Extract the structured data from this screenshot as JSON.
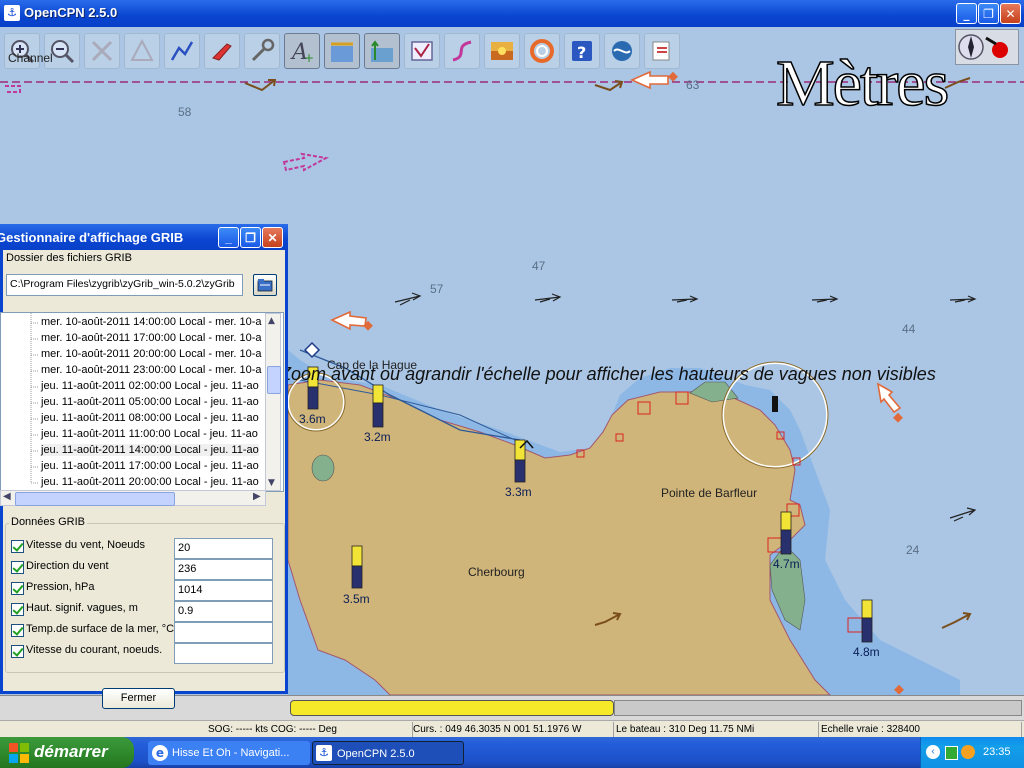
{
  "window": {
    "title": "OpenCPN 2.5.0",
    "buttons": {
      "minimize": "_",
      "maximize": "❐",
      "close": "✕"
    }
  },
  "toolbar": {
    "icons": [
      "zoom-in-icon",
      "zoom-out-icon",
      "scale-in-icon",
      "scale-out-icon",
      "route-icon",
      "ship-icon",
      "settings-icon",
      "text-icon",
      "tide-icon",
      "current-icon",
      "ais-icon",
      "track-icon",
      "color-scheme-icon",
      "mob-icon",
      "help-icon",
      "globe-icon",
      "print-icon"
    ],
    "channel_label": "Channel"
  },
  "chart": {
    "units_label": "Mètres",
    "banner": "Zoom avant ou agrandir l'échelle pour afficher les hauteurs de vagues non visibles",
    "depths": [
      "58",
      "63",
      "47",
      "57",
      "44",
      "24"
    ],
    "places": {
      "cap": "Cap de la Hague",
      "barfleur": "Pointe de Barfleur",
      "cherbourg": "Cherbourg"
    },
    "waves": [
      "3.6m",
      "3.2m",
      "3.3m",
      "4.7m",
      "3.5m",
      "4.8m"
    ]
  },
  "status": {
    "sog": "SOG: ----- kts  COG: ----- Deg",
    "position": "Curs. : 049 46.3035 N 001 51.1976 W",
    "bearing": "Le  bateau : 310 Deg   11.75 NMi",
    "scale": "Echelle vraie :   328400"
  },
  "taskbar": {
    "start": "démarrer",
    "tasks": [
      "Hisse Et Oh - Navigati...",
      "OpenCPN 2.5.0"
    ],
    "time": "23:35"
  },
  "grib": {
    "title": "Gestionnaire d'affichage GRIB",
    "folder_label": "Dossier des fichiers GRIB",
    "folder_path": "C:\\Program Files\\zygrib\\zyGrib_win-5.0.2\\zyGrib",
    "records": [
      "mer. 10-août-2011 14:00:00 Local - mer. 10-a",
      "mer. 10-août-2011 17:00:00 Local - mer. 10-a",
      "mer. 10-août-2011 20:00:00 Local - mer. 10-a",
      "mer. 10-août-2011 23:00:00 Local - mer. 10-a",
      "jeu. 11-août-2011 02:00:00 Local - jeu. 11-ao",
      "jeu. 11-août-2011 05:00:00 Local - jeu. 11-ao",
      "jeu. 11-août-2011 08:00:00 Local - jeu. 11-ao",
      "jeu. 11-août-2011 11:00:00 Local - jeu. 11-ao",
      "jeu. 11-août-2011 14:00:00 Local - jeu. 11-ao",
      "jeu. 11-août-2011 17:00:00 Local - jeu. 11-ao",
      "jeu. 11-août-2011 20:00:00 Local - jeu. 11-ao"
    ],
    "data_label": "Données GRIB",
    "fields": [
      {
        "label": "Vitesse du vent, Noeuds",
        "value": "20"
      },
      {
        "label": "Direction du vent",
        "value": "236"
      },
      {
        "label": "Pression, hPa",
        "value": "1014"
      },
      {
        "label": "Haut. signif. vagues, m",
        "value": " 0.9"
      },
      {
        "label": "Temp.de surface de la mer, °C",
        "value": ""
      },
      {
        "label": "Vitesse du courant, noeuds.",
        "value": ""
      }
    ],
    "close_button": "Fermer"
  }
}
